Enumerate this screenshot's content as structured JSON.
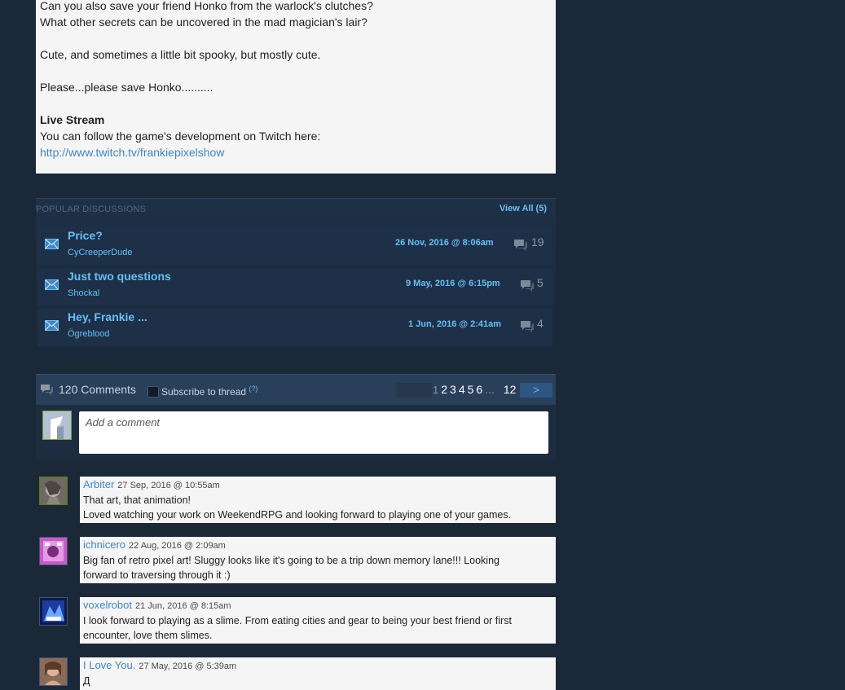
{
  "description": {
    "line1": "Can you also save your friend Honko from the warlock's clutches?",
    "line2": "What other secrets can be uncovered in the mad magician's lair?",
    "line3": "Cute, and sometimes a little bit spooky, but mostly cute.",
    "line4": "Please...please save Honko..........",
    "live_heading": "Live Stream",
    "live_text": "You can follow the game's development on Twitch here:",
    "live_link": "http://www.twitch.tv/frankiepixelshow"
  },
  "discussions": {
    "header": "POPULAR DISCUSSIONS",
    "view_all": "View All (5)",
    "items": [
      {
        "title": "Price?",
        "author": "CyCreeperDude",
        "date": "26 Nov, 2016 @ 8:06am",
        "count": "19"
      },
      {
        "title": "Just two questions",
        "author": "Shockal",
        "date": "9 May, 2016 @ 6:15pm",
        "count": "5"
      },
      {
        "title": "Hey, Frankie ...",
        "author": "Ögreblood",
        "date": "1 Jun, 2016 @ 2:41am",
        "count": "4"
      }
    ]
  },
  "comments_bar": {
    "count": "120 Comments",
    "subscribe": "Subscribe to thread",
    "help": "(?)",
    "pages": [
      "1",
      "2",
      "3",
      "4",
      "5",
      "6",
      "...",
      "12"
    ],
    "next": ">",
    "placeholder": "Add a comment"
  },
  "comments": [
    {
      "name": "Arbiter",
      "time": "27 Sep, 2016 @ 10:55am",
      "lines": [
        "That art, that animation!",
        "Loved watching your work on WeekendRPG and looking forward to playing one of your games."
      ]
    },
    {
      "name": "ichnicero",
      "time": "22 Aug, 2016 @ 2:09am",
      "lines": [
        "Big fan of retro pixel art! Sluggy looks like it's going to be a trip down memory lane!!! Looking",
        "forward to traversing through it :)"
      ]
    },
    {
      "name": "voxelrobot",
      "time": "21 Jun, 2016 @ 8:15am",
      "lines": [
        "I look forward to playing as a slime. From eating cities and gear to being your best friend or first",
        "encounter, love them slimes."
      ]
    },
    {
      "name": "I Love You.",
      "time": "27 May, 2016 @ 5:39am",
      "lines": [
        "Д"
      ]
    }
  ],
  "colors": {
    "page_bg": "#1b2838",
    "link": "#66c0f4",
    "comment_name": "#3f86c4"
  }
}
